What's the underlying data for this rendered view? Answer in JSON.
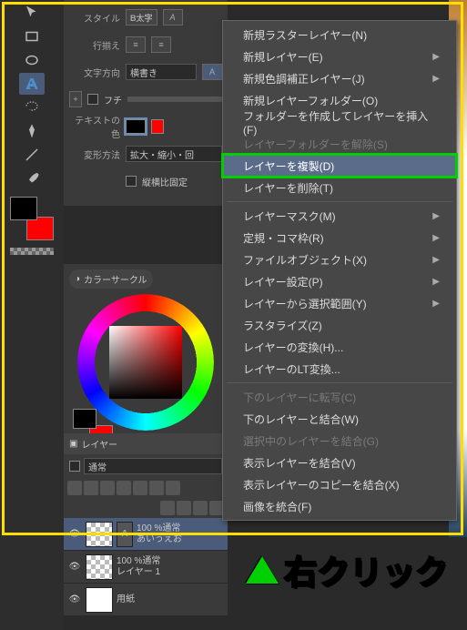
{
  "props": {
    "style_label": "スタイル",
    "style_bold": "B太字",
    "align_label": "行揃え",
    "dir_label": "文字方向",
    "dir_value": "横書き",
    "frame_label": "フチ",
    "textcolor_label": "テキストの色",
    "transform_label": "変形方法",
    "transform_value": "拡大・縮小・回",
    "lockaspect_label": "縦横比固定"
  },
  "color_panel": {
    "tab": "カラーサークル"
  },
  "layer_panel": {
    "title": "レイヤー",
    "blend": "通常",
    "layers": [
      {
        "opacity": "100 %通常",
        "name": "あいうえお",
        "sel": true,
        "text": true
      },
      {
        "opacity": "100 %通常",
        "name": "レイヤー 1",
        "sel": false,
        "text": false
      },
      {
        "opacity": "",
        "name": "用紙",
        "sel": false,
        "text": false
      }
    ]
  },
  "ctx": [
    {
      "t": "新規ラスターレイヤー(N)",
      "d": false,
      "s": false
    },
    {
      "t": "新規レイヤー(E)",
      "d": false,
      "s": true
    },
    {
      "t": "新規色調補正レイヤー(J)",
      "d": false,
      "s": true
    },
    {
      "t": "新規レイヤーフォルダー(O)",
      "d": false,
      "s": false
    },
    {
      "t": "フォルダーを作成してレイヤーを挿入(F)",
      "d": false,
      "s": false
    },
    {
      "t": "レイヤーフォルダーを解除(S)",
      "d": true,
      "s": false
    },
    {
      "t": "レイヤーを複製(D)",
      "d": false,
      "s": false,
      "hl": true
    },
    {
      "t": "レイヤーを削除(T)",
      "d": false,
      "s": false
    },
    {
      "sep": true
    },
    {
      "t": "レイヤーマスク(M)",
      "d": false,
      "s": true
    },
    {
      "t": "定規・コマ枠(R)",
      "d": false,
      "s": true
    },
    {
      "t": "ファイルオブジェクト(X)",
      "d": false,
      "s": true
    },
    {
      "t": "レイヤー設定(P)",
      "d": false,
      "s": true
    },
    {
      "t": "レイヤーから選択範囲(Y)",
      "d": false,
      "s": true
    },
    {
      "t": "ラスタライズ(Z)",
      "d": false,
      "s": false
    },
    {
      "t": "レイヤーの変換(H)...",
      "d": false,
      "s": false
    },
    {
      "t": "レイヤーのLT変換...",
      "d": false,
      "s": false
    },
    {
      "sep": true
    },
    {
      "t": "下のレイヤーに転写(C)",
      "d": true,
      "s": false
    },
    {
      "t": "下のレイヤーと結合(W)",
      "d": false,
      "s": false
    },
    {
      "t": "選択中のレイヤーを結合(G)",
      "d": true,
      "s": false
    },
    {
      "t": "表示レイヤーを結合(V)",
      "d": false,
      "s": false
    },
    {
      "t": "表示レイヤーのコピーを結合(X)",
      "d": false,
      "s": false
    },
    {
      "t": "画像を統合(F)",
      "d": false,
      "s": false
    }
  ],
  "annotation": "右クリック"
}
